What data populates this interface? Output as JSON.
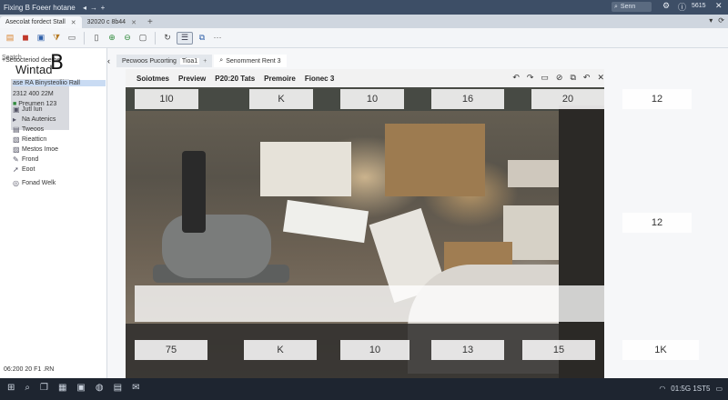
{
  "window": {
    "title": "Fixing B Foeer hotane",
    "search_label": "Senn",
    "tray_status": "5615"
  },
  "browser_tabs": [
    {
      "label": "Asecolat fordect Stall",
      "active": true
    },
    {
      "label": "32020 c 8b44",
      "active": false
    }
  ],
  "left_panel": {
    "search_hint": "Seatch",
    "header": "+Setiocteriod deethe",
    "big_letter": "B",
    "app_name": "Wintad",
    "line1": "ase RA Binysteoliio Rall",
    "line2": "2312 400 22M",
    "line3": "Preumen 123",
    "tree": [
      {
        "icon": "monitor-icon",
        "glyph": "▣",
        "label": "Jutl Iun"
      },
      {
        "icon": "bullet-icon",
        "glyph": "▸",
        "label": "Na Autenics"
      },
      {
        "icon": "terminal-icon",
        "glyph": "▤",
        "label": "Tweoos"
      },
      {
        "icon": "folder-icon",
        "glyph": "▧",
        "label": "Rieatticn"
      },
      {
        "icon": "image-icon",
        "glyph": "▨",
        "label": "Mestos Imoe"
      },
      {
        "icon": "pen-icon",
        "glyph": "✎",
        "label": "Frond"
      },
      {
        "icon": "pointer-icon",
        "glyph": "➚",
        "label": "Eoot"
      },
      {
        "icon": "globe-icon",
        "glyph": "◎",
        "label": "Fonad Welk"
      }
    ],
    "footer": "06:200 20 F1  .RN"
  },
  "doc_tabs": [
    {
      "label": "Pecwoos Pucorting",
      "chip": "Tioa1",
      "active": false
    },
    {
      "label": "Senomment Rent 3",
      "active": true
    }
  ],
  "overlay": {
    "headers": [
      "Soiotmes",
      "Preview",
      "P20:20 Tats",
      "Premoire",
      "Fionec 3"
    ],
    "tools": [
      "↶",
      "↷",
      "▭",
      "⊘",
      "⧉",
      "↶",
      "✕"
    ],
    "top_row": [
      "1I0",
      "K",
      "10",
      "16",
      "20",
      "12"
    ],
    "mid_row": [
      "12"
    ],
    "bottom_row": [
      "75",
      "K",
      "10",
      "13",
      "15",
      "1K"
    ]
  },
  "taskbar": {
    "icons": [
      "windows-icon",
      "search-icon",
      "taskview-icon",
      "widget-icon",
      "folder-icon",
      "edge-icon",
      "store-icon",
      "mail-icon"
    ],
    "right_text": "01:5G  1ST5"
  }
}
